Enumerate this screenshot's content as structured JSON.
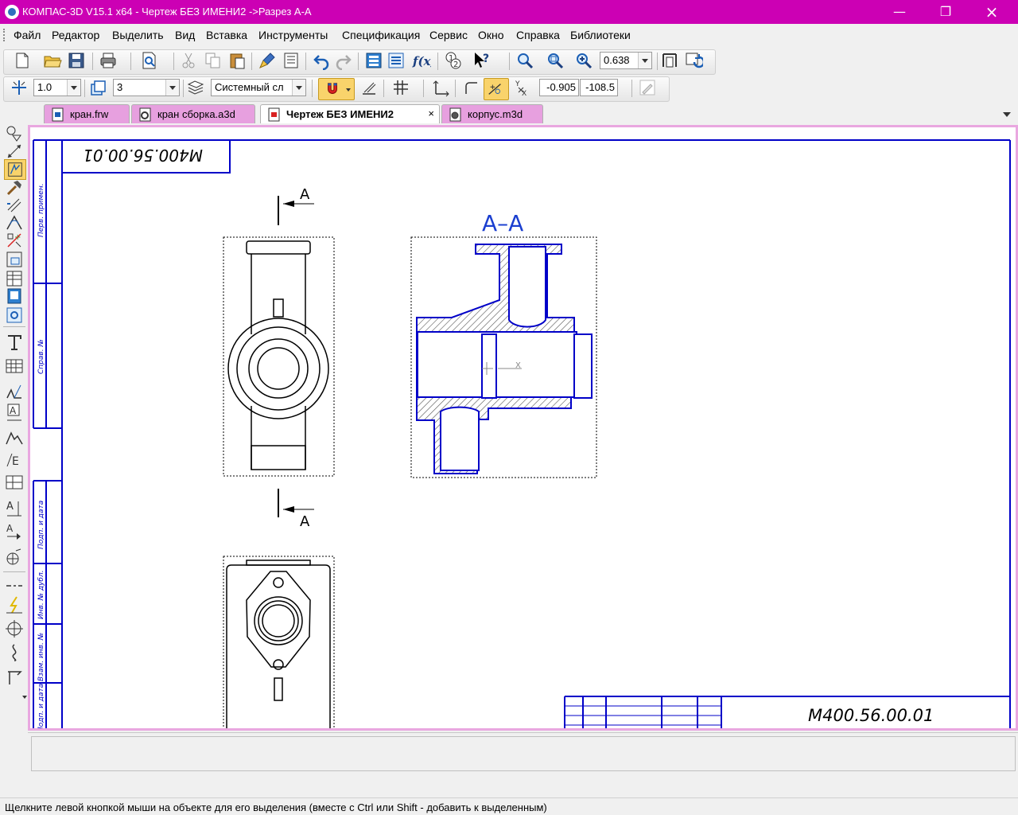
{
  "window": {
    "title": "КОМПАС-3D V15.1 x64 - Чертеж БЕЗ ИМЕНИ2 ->Разрез А-А"
  },
  "menu": [
    "Файл",
    "Редактор",
    "Выделить",
    "Вид",
    "Вставка",
    "Инструменты",
    "Спецификация",
    "Сервис",
    "Окно",
    "Справка",
    "Библиотеки"
  ],
  "toolbar": {
    "zoom": "0.638",
    "line_scale": "1.0",
    "layer": "3",
    "style": "Системный сл",
    "coord_x": "-0.905",
    "coord_y": "-108.5"
  },
  "tabs": [
    {
      "label": "кран.frw",
      "state": "inactive",
      "icon": "drawing-icon"
    },
    {
      "label": "кран сборка.a3d",
      "state": "inactive",
      "icon": "assembly-icon"
    },
    {
      "label": "Чертеж БЕЗ ИМЕНИ2",
      "state": "active",
      "icon": "drawing-icon",
      "close": "×"
    },
    {
      "label": "корпус.m3d",
      "state": "inactive",
      "icon": "part-icon"
    }
  ],
  "drawing": {
    "designation_top": "М400.56.00.01",
    "designation_stamp": "М400.56.00.01",
    "section_title": "А–А",
    "section_letter": "А",
    "axis_label": "X",
    "margin_labels": [
      "Перв. примен.",
      "Справ. №",
      "Подп. и дата",
      "Инв. № дубл.",
      "Взам. инв. №",
      "Подп. и дата"
    ]
  },
  "status": {
    "hint": "Щелкните левой кнопкой мыши на объекте для его выделения (вместе с Ctrl или Shift - добавить к выделенным)"
  },
  "colors": {
    "titlebar": "#cc00b4",
    "tab_inactive": "#e7a0df",
    "frame": "#0000c8",
    "hatch": "#555555"
  }
}
